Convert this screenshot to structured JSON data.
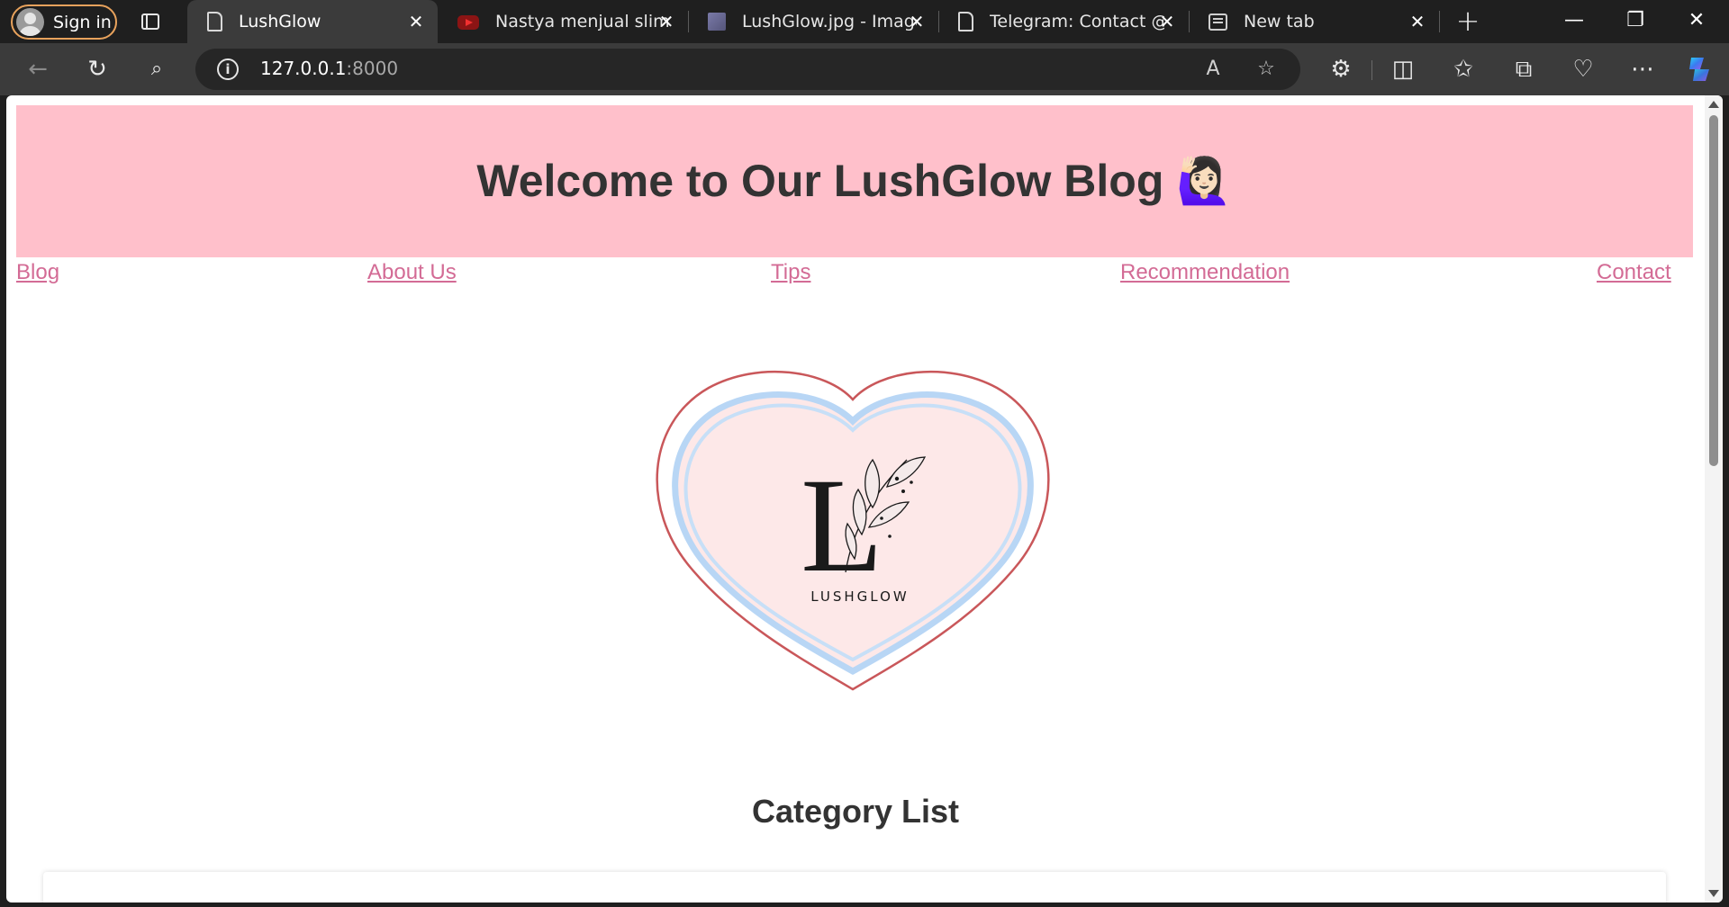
{
  "browser": {
    "signin_label": "Sign in",
    "tabs": [
      {
        "title": "LushGlow",
        "icon": "document-icon",
        "active": true
      },
      {
        "title": "Nastya menjual slime d",
        "icon": "youtube-icon",
        "active": false
      },
      {
        "title": "LushGlow.jpg - Image v",
        "icon": "image-icon",
        "active": false
      },
      {
        "title": "Telegram: Contact @m",
        "icon": "document-icon",
        "active": false
      },
      {
        "title": "New tab",
        "icon": "new-tab-icon",
        "active": false
      }
    ],
    "address": {
      "host": "127.0.0.1",
      "port": ":8000"
    }
  },
  "page": {
    "header_title": "Welcome to Our LushGlow Blog",
    "header_emoji": "🙋🏻‍♀️",
    "nav": [
      "Blog",
      "About Us",
      "Tips",
      "Recommendation",
      "Contact"
    ],
    "logo_text": "LUSHGLOW",
    "logo_letter": "L",
    "section_title": "Category List"
  },
  "colors": {
    "header_bg": "#ffc0cb",
    "link": "#d36b95",
    "heart_outline": "#c9575a",
    "heart_ring": "#b8d6f5",
    "heart_fill": "#fde8e8"
  }
}
